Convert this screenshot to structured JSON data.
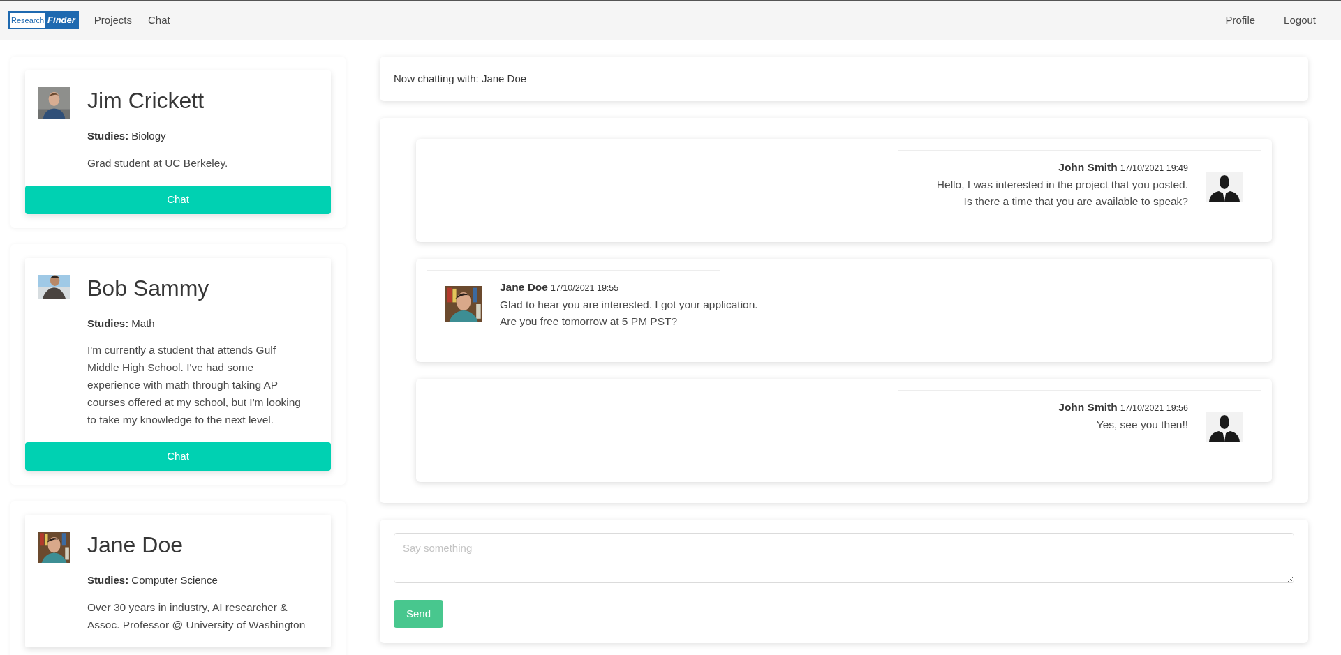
{
  "navbar": {
    "logo": {
      "part_1": "Research",
      "part_2": "Finder"
    },
    "links": [
      {
        "label": "Projects"
      },
      {
        "label": "Chat"
      }
    ],
    "right_links": [
      {
        "label": "Profile"
      },
      {
        "label": "Logout"
      }
    ]
  },
  "people": [
    {
      "name": "Jim Crickett",
      "studies_label": "Studies:",
      "studies": "Biology",
      "bio": "Grad student at UC Berkeley.",
      "button": "Chat"
    },
    {
      "name": "Bob Sammy",
      "studies_label": "Studies:",
      "studies": "Math",
      "bio": "I'm currently a student that attends Gulf Middle High School. I've had some experience with math through taking AP courses offered at my school, but I'm looking to take my knowledge to the next level.",
      "button": "Chat"
    },
    {
      "name": "Jane Doe",
      "studies_label": "Studies:",
      "studies": "Computer Science",
      "bio": "Over 30 years in industry, AI researcher & Assoc. Professor @ University of Washington"
    }
  ],
  "chat_header": "Now chatting with: Jane Doe",
  "messages": [
    {
      "kind": "outgoing",
      "sender": "John Smith",
      "time": "17/10/2021 19:49",
      "lines": [
        "Hello, I was interested in the project that you posted.",
        "Is there a time that you are available to speak?"
      ]
    },
    {
      "kind": "incoming",
      "sender": "Jane Doe",
      "time": "17/10/2021 19:55",
      "lines": [
        "Glad to hear you are interested. I got your application.",
        "Are you free tomorrow at 5 PM PST?"
      ]
    },
    {
      "kind": "outgoing",
      "sender": "John Smith",
      "time": "17/10/2021 19:56",
      "lines": [
        "Yes, see you then!!"
      ]
    }
  ],
  "composer": {
    "placeholder": "Say something",
    "button": "Send"
  }
}
